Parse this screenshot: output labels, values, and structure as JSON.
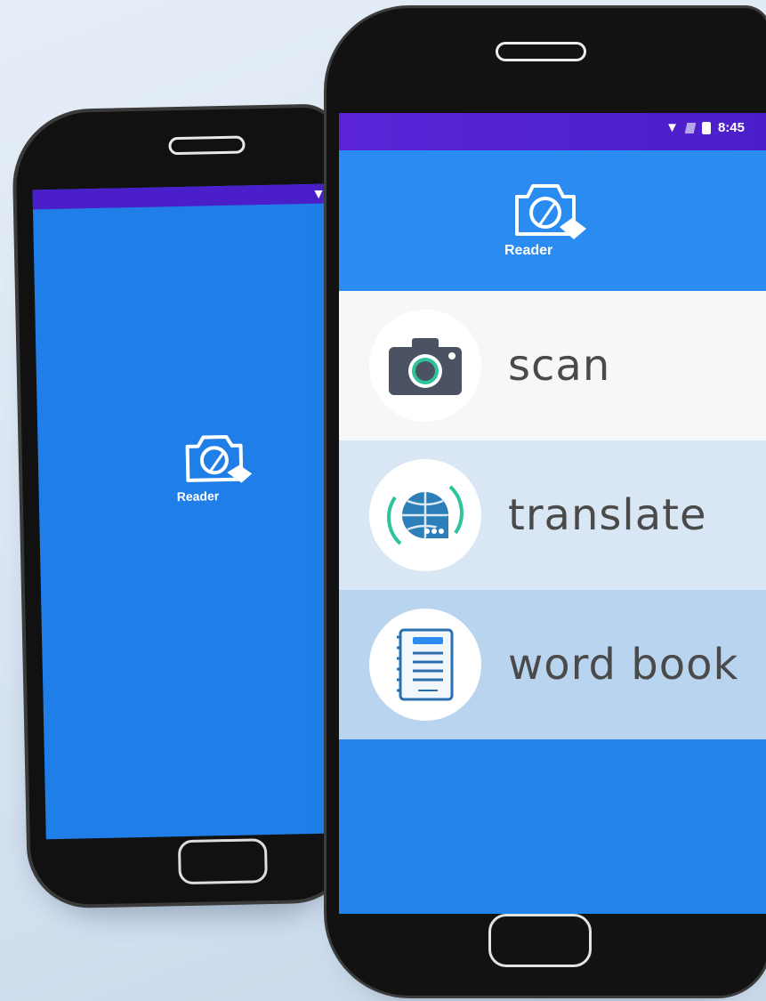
{
  "back_phone": {
    "logo_text": "Reader"
  },
  "front_phone": {
    "status_bar": {
      "time": "8:45"
    },
    "header": {
      "logo_text": "Reader"
    },
    "menu": [
      {
        "label": "scan",
        "icon": "camera-icon"
      },
      {
        "label": "translate",
        "icon": "globe-translate-icon"
      },
      {
        "label": "word book",
        "icon": "notebook-icon"
      }
    ]
  },
  "colors": {
    "primary_blue": "#2384ec",
    "status_purple": "#4a1fc9",
    "item_scan_bg": "#f6f7f9",
    "item_translate_bg": "#d9e6f3",
    "item_wordbook_bg": "#b9d4ef"
  }
}
